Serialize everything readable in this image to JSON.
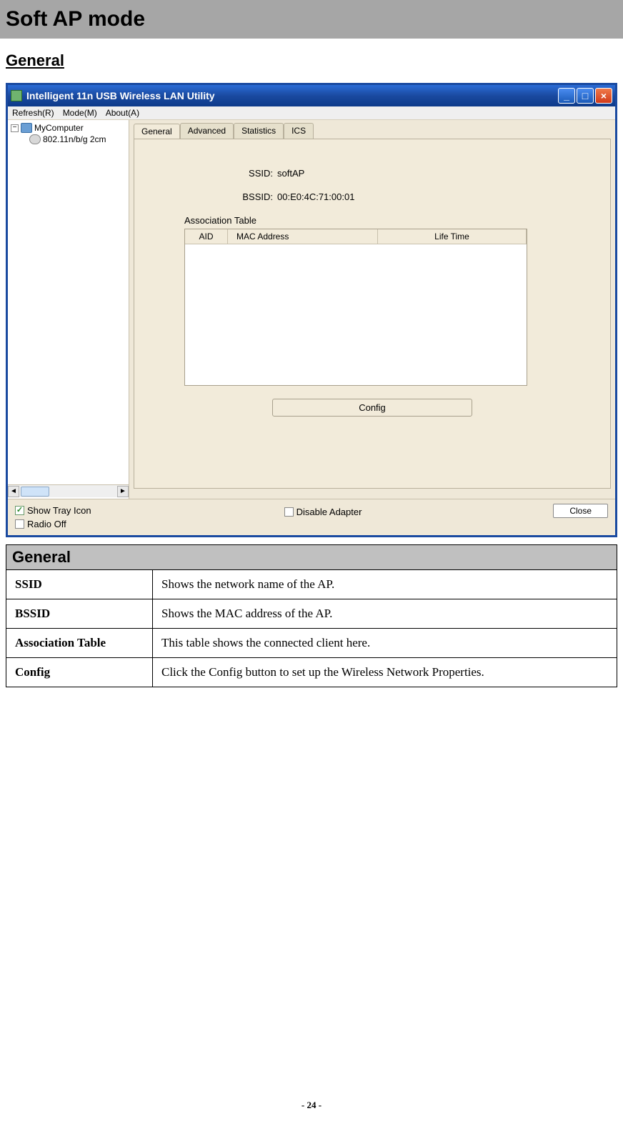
{
  "doc": {
    "section_title": "Soft AP mode",
    "subsection_title": "General",
    "page_number": "- 24 -"
  },
  "app": {
    "title": "Intelligent 11n USB Wireless LAN Utility",
    "menu": {
      "refresh": "Refresh(R)",
      "mode": "Mode(M)",
      "about": "About(A)"
    },
    "tree": {
      "root": "MyComputer",
      "child": "802.11n/b/g 2cm"
    },
    "tabs": {
      "general": "General",
      "advanced": "Advanced",
      "statistics": "Statistics",
      "ics": "ICS"
    },
    "fields": {
      "ssid_label": "SSID:",
      "ssid_value": "softAP",
      "bssid_label": "BSSID:",
      "bssid_value": "00:E0:4C:71:00:01",
      "assoc_label": "Association Table",
      "col_aid": "AID",
      "col_mac": "MAC Address",
      "col_life": "Life Time",
      "config_btn": "Config"
    },
    "bottom": {
      "show_tray": "Show Tray Icon",
      "radio_off": "Radio Off",
      "disable_adapter": "Disable Adapter",
      "close": "Close"
    }
  },
  "table": {
    "header": "General",
    "rows": [
      {
        "key": "SSID",
        "val": "Shows the network name of the AP."
      },
      {
        "key": "BSSID",
        "val": "Shows the MAC address of the AP."
      },
      {
        "key": "Association Table",
        "val": "This table shows the connected client here."
      },
      {
        "key": "Config",
        "val": "Click the Config button to set up the Wireless Network Properties."
      }
    ]
  }
}
